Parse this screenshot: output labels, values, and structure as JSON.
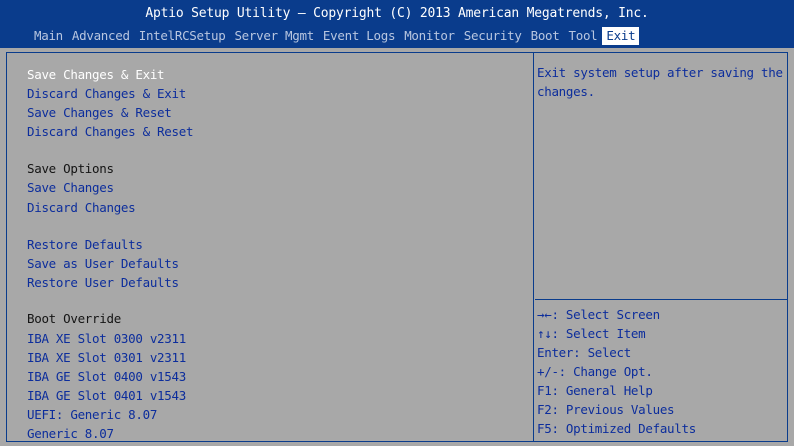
{
  "header": {
    "title": "Aptio Setup Utility – Copyright (C) 2013 American Megatrends, Inc.",
    "tabs": [
      "Main",
      "Advanced",
      "IntelRCSetup",
      "Server Mgmt",
      "Event Logs",
      "Monitor",
      "Security",
      "Boot",
      "Tool",
      "Exit"
    ],
    "active_tab": "Exit"
  },
  "menu": {
    "items": [
      "Save Changes & Exit",
      "Discard Changes & Exit",
      "Save Changes & Reset",
      "Discard Changes & Reset",
      "Save Options",
      "Save Changes",
      "Discard Changes",
      "Restore Defaults",
      "Save as User Defaults",
      "Restore User Defaults",
      "Boot Override",
      "IBA XE Slot 0300 v2311",
      "IBA XE Slot 0301 v2311",
      "IBA GE Slot 0400 v1543",
      "IBA GE Slot 0401 v1543",
      "UEFI: Generic 8.07",
      "Generic 8.07"
    ],
    "selected": "Save Changes & Exit"
  },
  "help": {
    "text": "Exit system setup after saving the changes."
  },
  "keys": [
    "→←: Select Screen",
    "↑↓: Select Item",
    "Enter: Select",
    "+/-: Change Opt.",
    "F1: General Help",
    "F2: Previous Values",
    "F5: Optimized Defaults"
  ],
  "colors": {
    "header_bg": "#0a3c8c",
    "body_bg": "#a8a8a8",
    "item_text": "#0c2d9c",
    "selected_text": "#ffffff",
    "label_text": "#141414"
  }
}
